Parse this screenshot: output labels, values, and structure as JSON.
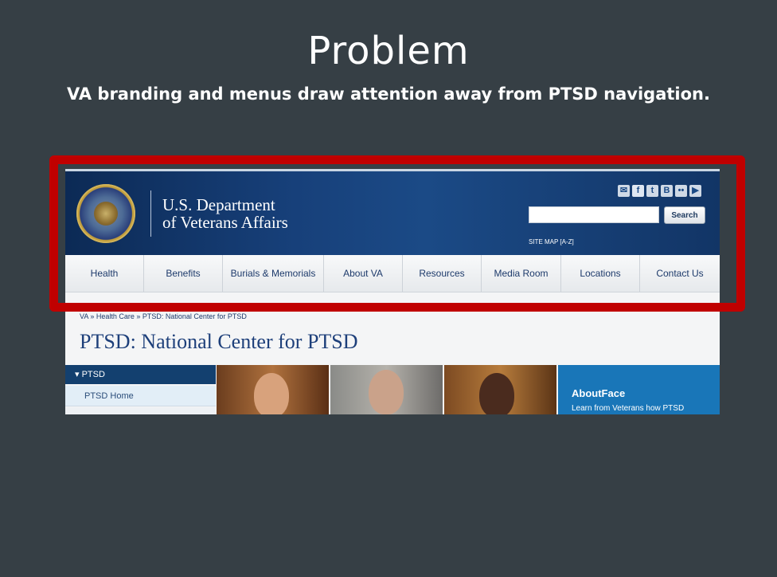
{
  "slide": {
    "title": "Problem",
    "subtitle": "VA branding and menus draw attention away from PTSD navigation."
  },
  "header": {
    "seal": "va-seal-logo",
    "dept_line1": "U.S. Department",
    "dept_line2": "of Veterans Affairs",
    "social_icons": [
      "email-icon",
      "facebook-icon",
      "twitter-icon",
      "blog-icon",
      "flickr-icon",
      "youtube-icon"
    ],
    "social_glyphs": [
      "✉",
      "f",
      "t",
      "B",
      "••",
      "▶"
    ],
    "search": {
      "value": "",
      "placeholder": "",
      "button_label": "Search"
    },
    "site_map": "SITE MAP [A-Z]"
  },
  "nav": {
    "items": [
      "Health",
      "Benefits",
      "Burials & Memorials",
      "About VA",
      "Resources",
      "Media Room",
      "Locations",
      "Contact Us"
    ]
  },
  "breadcrumb": "VA » Health Care » PTSD: National Center for PTSD",
  "page_title": "PTSD: National Center for PTSD",
  "left_nav": {
    "head": "▾ PTSD",
    "items": [
      "PTSD Home"
    ]
  },
  "promo": {
    "title": "AboutFace",
    "text": "Learn from Veterans how PTSD"
  },
  "colors": {
    "highlight": "#c00000",
    "va_navy": "#0c2a55",
    "promo_blue": "#1976b8",
    "slide_bg": "#363f45"
  }
}
